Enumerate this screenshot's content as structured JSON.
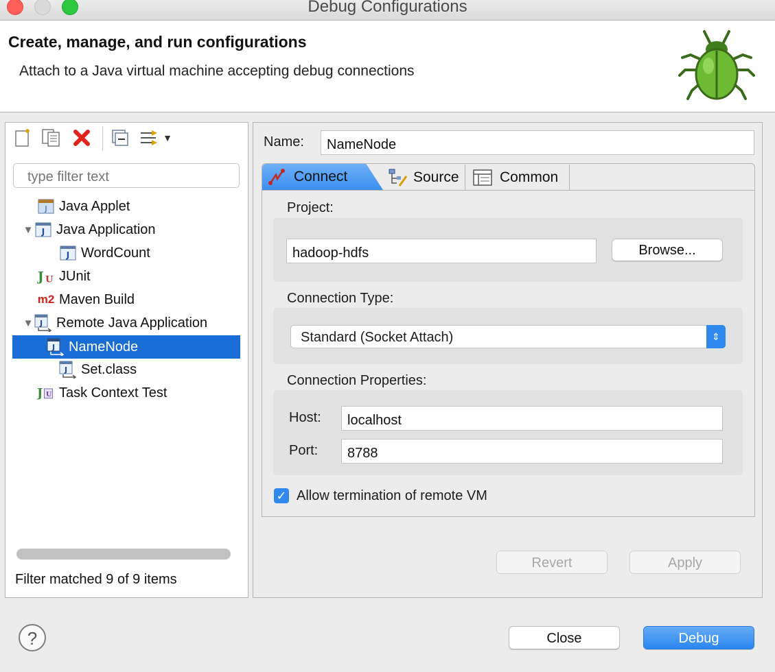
{
  "window": {
    "title": "Debug Configurations"
  },
  "header": {
    "title": "Create, manage, and run configurations",
    "subtitle": "Attach to a Java virtual machine accepting debug connections",
    "logo_icon": "bug-icon"
  },
  "toolbar": {
    "icons": [
      "new-config-icon",
      "duplicate-icon",
      "delete-icon",
      "collapse-all-icon",
      "filter-icon"
    ]
  },
  "filter": {
    "placeholder": "type filter text"
  },
  "tree": {
    "items": [
      {
        "label": "Java Applet",
        "icon": "java-applet-icon"
      },
      {
        "label": "Java Application",
        "icon": "java-app-icon",
        "expanded": true
      },
      {
        "label": "WordCount",
        "icon": "java-app-icon"
      },
      {
        "label": "JUnit",
        "icon": "junit-icon"
      },
      {
        "label": "Maven Build",
        "icon": "maven-icon",
        "icon_text": "m2"
      },
      {
        "label": "Remote Java Application",
        "icon": "remote-java-icon",
        "expanded": true
      },
      {
        "label": "NameNode",
        "icon": "remote-java-icon",
        "selected": true
      },
      {
        "label": "Set.class",
        "icon": "remote-java-icon"
      },
      {
        "label": "Task Context Test",
        "icon": "task-context-icon"
      }
    ],
    "status": "Filter matched 9 of 9 items"
  },
  "config": {
    "name_label": "Name:",
    "name_value": "NameNode",
    "tabs": [
      {
        "label": "Connect",
        "active": true,
        "icon": "connect-icon"
      },
      {
        "label": "Source",
        "active": false,
        "icon": "source-icon"
      },
      {
        "label": "Common",
        "active": false,
        "icon": "common-icon"
      }
    ],
    "project_label": "Project:",
    "project_value": "hadoop-hdfs",
    "browse_label": "Browse...",
    "connection_type_label": "Connection Type:",
    "connection_type_value": "Standard (Socket Attach)",
    "connection_props_label": "Connection Properties:",
    "host_label": "Host:",
    "host_value": "localhost",
    "port_label": "Port:",
    "port_value": "8788",
    "allow_termination_label": "Allow termination of remote VM",
    "allow_termination_checked": true,
    "revert_label": "Revert",
    "apply_label": "Apply"
  },
  "footer": {
    "close_label": "Close",
    "debug_label": "Debug",
    "help_icon": "help-icon",
    "help_glyph": "?"
  }
}
